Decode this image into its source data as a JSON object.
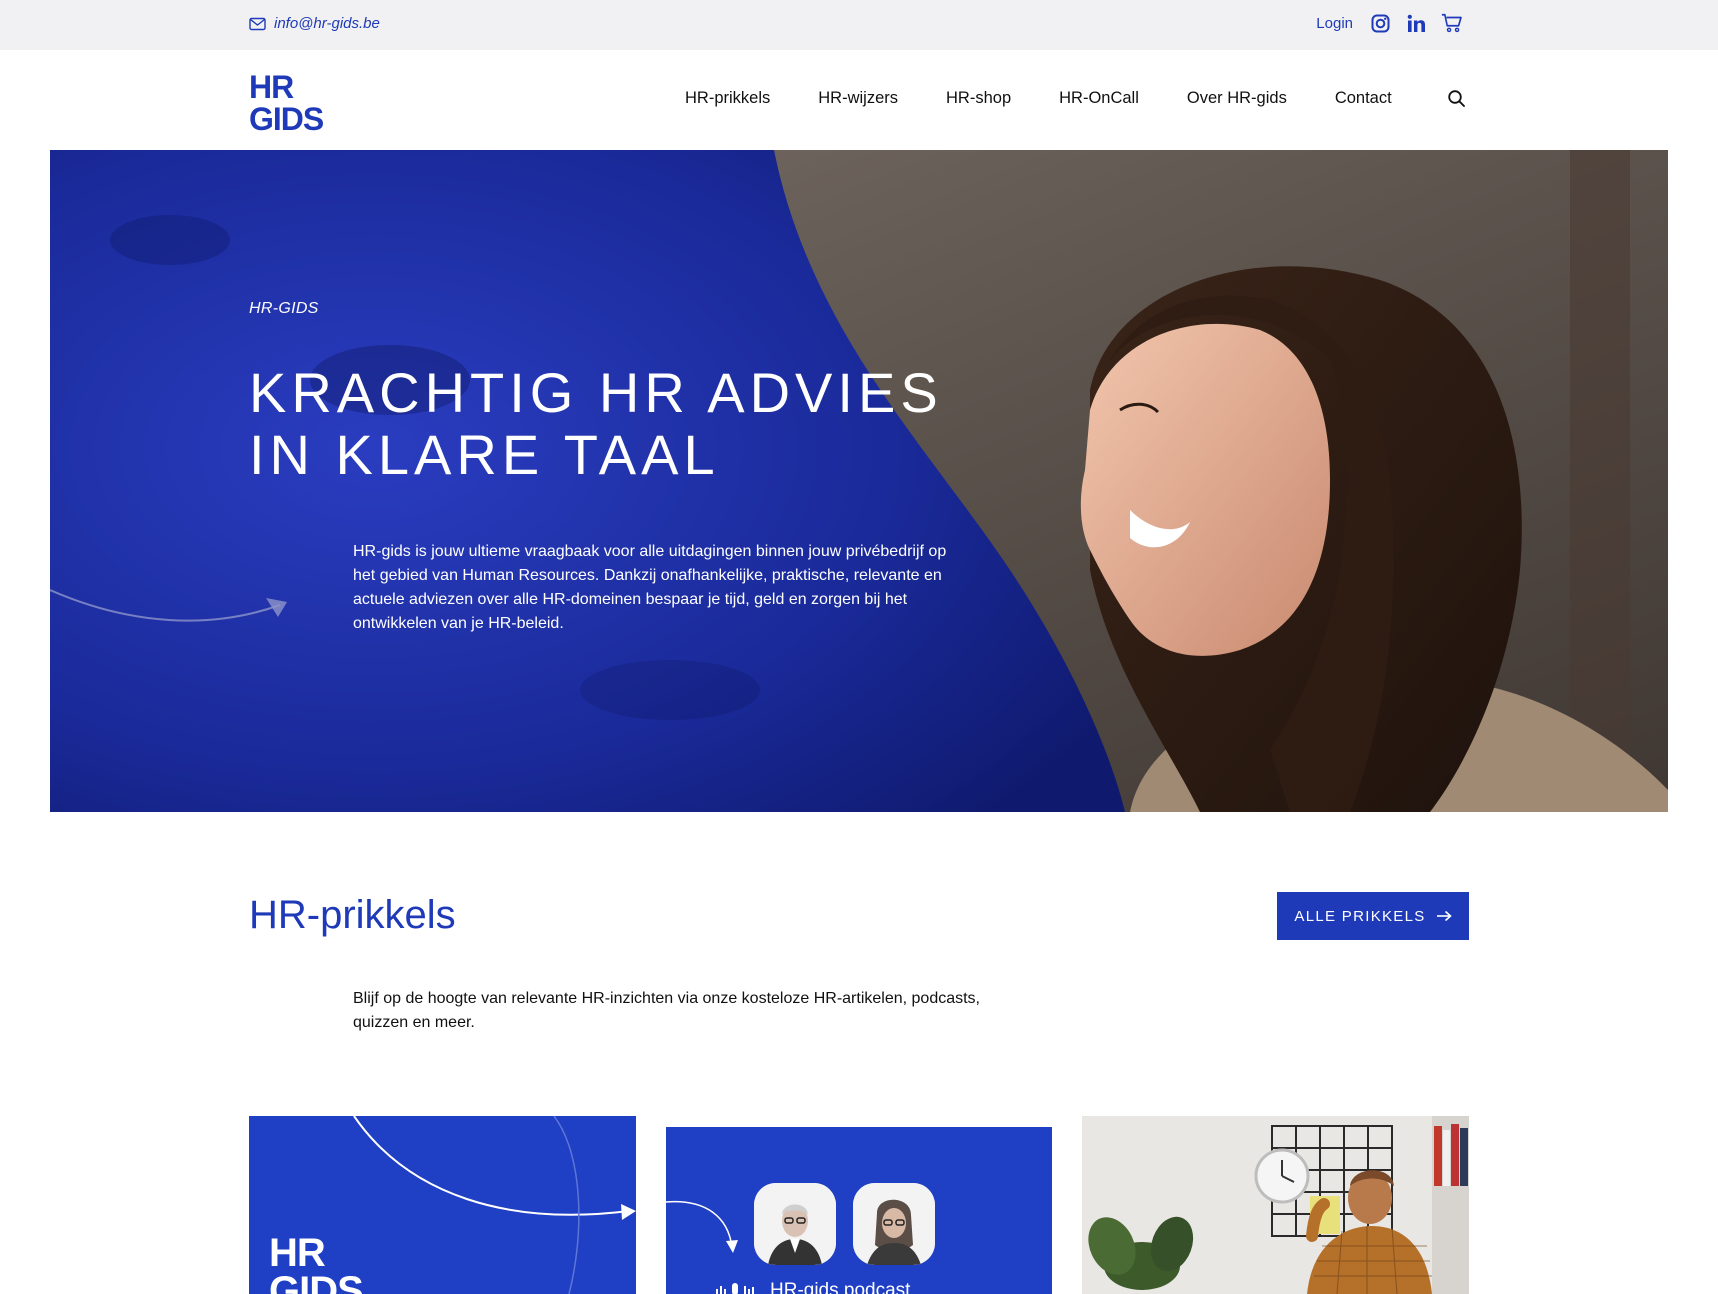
{
  "topbar": {
    "email": "info@hr-gids.be",
    "login": "Login",
    "icons": [
      "mail-icon",
      "instagram-icon",
      "linkedin-icon",
      "cart-icon"
    ]
  },
  "header": {
    "logo_text": [
      "HR",
      "GIDS"
    ],
    "nav": [
      "HR-prikkels",
      "HR-wijzers",
      "HR-shop",
      "HR-OnCall",
      "Over HR-gids",
      "Contact"
    ],
    "search_icon": "search-icon"
  },
  "hero": {
    "kicker": "HR-GIDS",
    "title": "KRACHTIG HR ADVIES IN KLARE TAAL",
    "lead": "HR-gids is jouw ultieme vraagbaak voor alle uitdagingen binnen jouw privébedrijf op het gebied van Human Resources. Dankzij onafhankelijke, praktische, relevante en actuele adviezen over alle HR-domeinen bespaar je tijd, geld en zorgen bij het ontwikkelen van je HR-beleid."
  },
  "prikkels": {
    "title": "HR-prikkels",
    "button": "ALLE PRIKKELS",
    "lead": "Blijf op de hoogte van relevante HR-inzichten via onze kosteloze HR-artikelen, podcasts, quizzen en meer.",
    "cards": [
      {
        "type": "logo-card",
        "logo_text": [
          "HR",
          "GIDS"
        ]
      },
      {
        "type": "podcast-card",
        "label": "HR-gids podcast"
      },
      {
        "type": "photo-card"
      }
    ]
  },
  "colors": {
    "brand_blue": "#1e3ab8",
    "hero_blue": "#1a2a9a",
    "topbar_bg": "#f1f1f3"
  }
}
